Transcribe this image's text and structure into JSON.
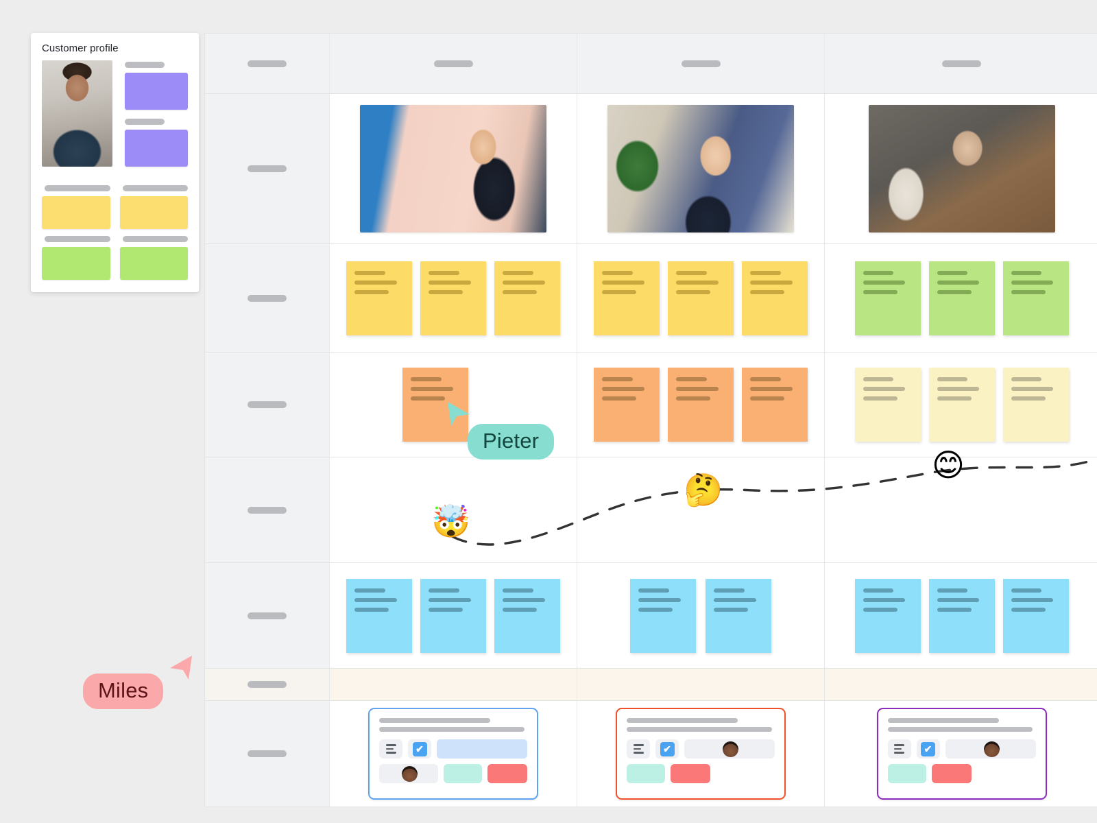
{
  "board": {
    "background_color": "#ededed",
    "grid_line_color": "#e3e4e6",
    "header_row_bg": "#f1f2f4",
    "highlight_row_bg": "#fcf5ec"
  },
  "profile_card": {
    "title": "Customer profile",
    "photo_alt": "customer-portrait",
    "swatch_colors": {
      "purple": "#9b8cf7",
      "yellow": "#fcdd6f",
      "green": "#b1e871",
      "label_pill": "#bbbdc0"
    },
    "purple_blocks": 2,
    "yellow_blocks": 2,
    "green_blocks": 2
  },
  "grid": {
    "columns": [
      {
        "name": "row-header-column",
        "label_redacted": true
      },
      {
        "name": "column-1",
        "label_redacted": true
      },
      {
        "name": "column-2",
        "label_redacted": true
      },
      {
        "name": "column-3",
        "label_redacted": true
      }
    ],
    "rows": [
      {
        "name": "header-row",
        "label_redacted": true,
        "type": "header"
      },
      {
        "name": "photos-row",
        "label_redacted": true,
        "type": "photos"
      },
      {
        "name": "yellow-notes-row",
        "label_redacted": true,
        "type": "notes"
      },
      {
        "name": "orange-notes-row",
        "label_redacted": true,
        "type": "notes"
      },
      {
        "name": "emotion-row",
        "label_redacted": true,
        "type": "emoji-curve"
      },
      {
        "name": "blue-notes-row",
        "label_redacted": true,
        "type": "notes"
      },
      {
        "name": "highlight-row",
        "label_redacted": true,
        "type": "spacer",
        "highlighted": true
      },
      {
        "name": "cards-row",
        "label_redacted": true,
        "type": "cards"
      }
    ]
  },
  "photos": [
    {
      "name": "photo-woman-laptop-cafe",
      "alt": "Woman working on laptop in pink cafe"
    },
    {
      "name": "photo-woman-phone-call",
      "alt": "Smiling woman talking on mobile phone"
    },
    {
      "name": "photo-team-meeting",
      "alt": "Three people with laptops at a table"
    }
  ],
  "notes": {
    "colors": {
      "yellow": "#fcdb66",
      "green": "#b9e583",
      "orange": "#fab072",
      "cream": "#fbf2c4",
      "blue": "#8ee0fa"
    },
    "rows": [
      {
        "name": "yellow-notes-row",
        "groups": [
          {
            "column": 1,
            "color": "yellow",
            "count": 3
          },
          {
            "column": 2,
            "color": "yellow",
            "count": 3
          },
          {
            "column": 3,
            "color": "green",
            "count": 3
          }
        ]
      },
      {
        "name": "orange-notes-row",
        "groups": [
          {
            "column": 1,
            "color": "orange",
            "count": 1
          },
          {
            "column": 2,
            "color": "orange",
            "count": 3
          },
          {
            "column": 3,
            "color": "cream",
            "count": 3
          }
        ]
      },
      {
        "name": "blue-notes-row",
        "groups": [
          {
            "column": 1,
            "color": "blue",
            "count": 3
          },
          {
            "column": 2,
            "color": "blue",
            "count": 2
          },
          {
            "column": 3,
            "color": "blue",
            "count": 3
          }
        ]
      }
    ]
  },
  "emotion_curve": {
    "name": "customer-emotion-journey",
    "line_style": "dashed",
    "line_color": "#333333",
    "points": [
      {
        "emoji": "🤯",
        "name": "exploding-head-emoji",
        "label": "frustrated"
      },
      {
        "emoji": "🤔",
        "name": "thinking-face-emoji",
        "label": "considering"
      },
      {
        "emoji": "😊",
        "name": "smiling-face-emoji",
        "label": "delighted"
      }
    ]
  },
  "cursors": [
    {
      "name": "cursor-pieter",
      "label": "Pieter",
      "color": "#86ddd0",
      "text_color": "#12463f"
    },
    {
      "name": "cursor-miles",
      "label": "Miles",
      "color": "#fba8ab",
      "text_color": "#5b1418"
    }
  ],
  "bottom_cards": [
    {
      "name": "task-card-blue",
      "border_color": "#5fa3ef",
      "chips": [
        "description-icon",
        "checkbox-checked",
        "blue-field"
      ],
      "second_row": [
        "avatar-field",
        "mint-tag",
        "red-tag"
      ]
    },
    {
      "name": "task-card-red",
      "border_color": "#f0502a",
      "chips": [
        "description-icon",
        "checkbox-checked",
        "avatar-field"
      ],
      "second_row": [
        "mint-tag",
        "red-tag"
      ]
    },
    {
      "name": "task-card-purple",
      "border_color": "#8b2bbd",
      "chips": [
        "description-icon",
        "checkbox-checked",
        "avatar-field"
      ],
      "second_row": [
        "mint-tag",
        "red-tag"
      ]
    }
  ],
  "icons": {
    "checkbox_glyph": "✔",
    "description_icon": "description-lines-icon"
  }
}
